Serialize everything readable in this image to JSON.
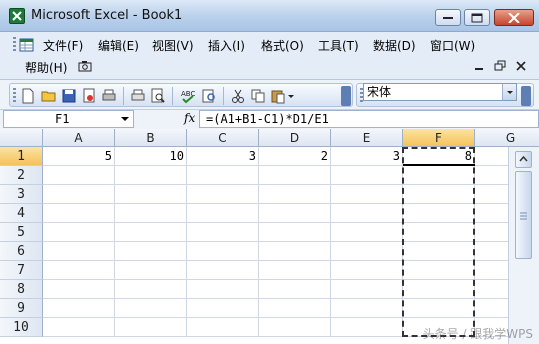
{
  "window": {
    "title": "Microsoft Excel - Book1"
  },
  "menu": {
    "items": [
      "文件(F)",
      "编辑(E)",
      "视图(V)",
      "插入(I)",
      "格式(O)",
      "工具(T)",
      "数据(D)",
      "窗口(W)"
    ],
    "help": "帮助(H)"
  },
  "toolbar": {
    "font_name": "宋体"
  },
  "formula_bar": {
    "name_box": "F1",
    "fx": "fx",
    "formula": "=(A1+B1-C1)*D1/E1"
  },
  "sheet": {
    "columns": [
      "A",
      "B",
      "C",
      "D",
      "E",
      "F",
      "G"
    ],
    "active_column": "F",
    "rows": [
      "1",
      "2",
      "3",
      "4",
      "5",
      "6",
      "7",
      "8",
      "9",
      "10"
    ],
    "active_row": "1",
    "row1_values": {
      "A": "5",
      "B": "10",
      "C": "3",
      "D": "2",
      "E": "3",
      "F": "8"
    }
  },
  "watermark": "头条号 / 跟我学WPS",
  "colors": {
    "accent_header": "#f5c25a",
    "title_gradient": "#b9d0ea"
  }
}
